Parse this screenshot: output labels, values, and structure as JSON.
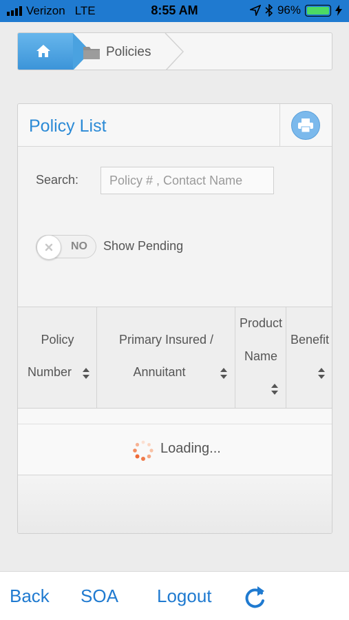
{
  "status_bar": {
    "carrier": "Verizon",
    "network": "LTE",
    "time": "8:55 AM",
    "battery": "96%"
  },
  "breadcrumb": {
    "items": [
      {
        "label": "",
        "icon": "home-icon"
      },
      {
        "label": "Policies",
        "icon": "folder-icon"
      }
    ]
  },
  "panel": {
    "title": "Policy List",
    "print_icon": "print-icon",
    "search": {
      "label": "Search:",
      "placeholder": "Policy # , Contact Name",
      "value": ""
    },
    "toggle": {
      "state_text": "NO",
      "label": "Show Pending"
    },
    "table": {
      "columns": [
        {
          "line1": "Policy",
          "line2": "Number"
        },
        {
          "line1": "Primary Insured /",
          "line2": "Annuitant"
        },
        {
          "line1": "Product",
          "line2": "Name"
        },
        {
          "line1": "Benefit",
          "line2": ""
        }
      ],
      "loading_text": "Loading..."
    }
  },
  "bottom_nav": {
    "back": "Back",
    "soa": "SOA",
    "logout": "Logout",
    "refresh_icon": "refresh-icon"
  },
  "colors": {
    "accent": "#1f7ad0",
    "title": "#2b8ad6",
    "breadcrumb_home": "#4aa2e0",
    "battery": "#4cd964"
  }
}
